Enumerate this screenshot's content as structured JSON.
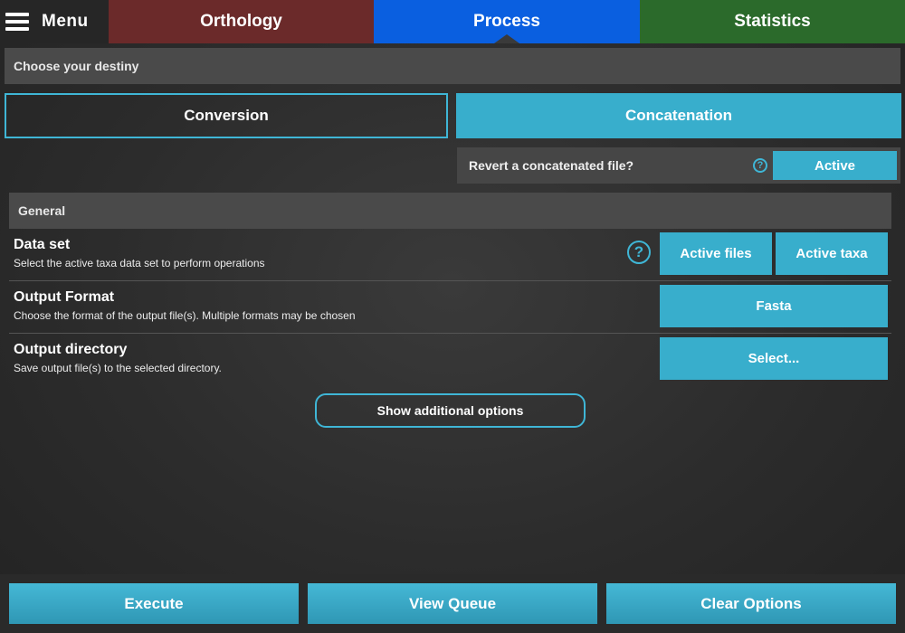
{
  "menu": {
    "label": "Menu",
    "icon": "hamburger-icon"
  },
  "tabs": {
    "orthology": "Orthology",
    "process": "Process",
    "statistics": "Statistics"
  },
  "destiny": {
    "header": "Choose your destiny",
    "conversion": "Conversion",
    "concatenation": "Concatenation",
    "revert_label": "Revert a concatenated file?",
    "revert_help": "?",
    "revert_value": "Active"
  },
  "general": {
    "header": "General",
    "data_set": {
      "title": "Data set",
      "description": "Select the active taxa data set to perform operations",
      "help": "?",
      "option_files": "Active files",
      "option_taxa": "Active taxa"
    },
    "output_format": {
      "title": "Output Format",
      "description": "Choose the format of the output file(s). Multiple formats may be chosen",
      "value": "Fasta"
    },
    "output_directory": {
      "title": "Output directory",
      "description": "Save output file(s) to the selected directory.",
      "value": "Select..."
    },
    "more_options": "Show additional options"
  },
  "footer": {
    "execute": "Execute",
    "view_queue": "View Queue",
    "clear_options": "Clear Options"
  },
  "colors": {
    "accent": "#38aecc",
    "tab_orthology": "#6b2a2a",
    "tab_process": "#0a5fe0",
    "tab_statistics": "#2b6a2b"
  }
}
